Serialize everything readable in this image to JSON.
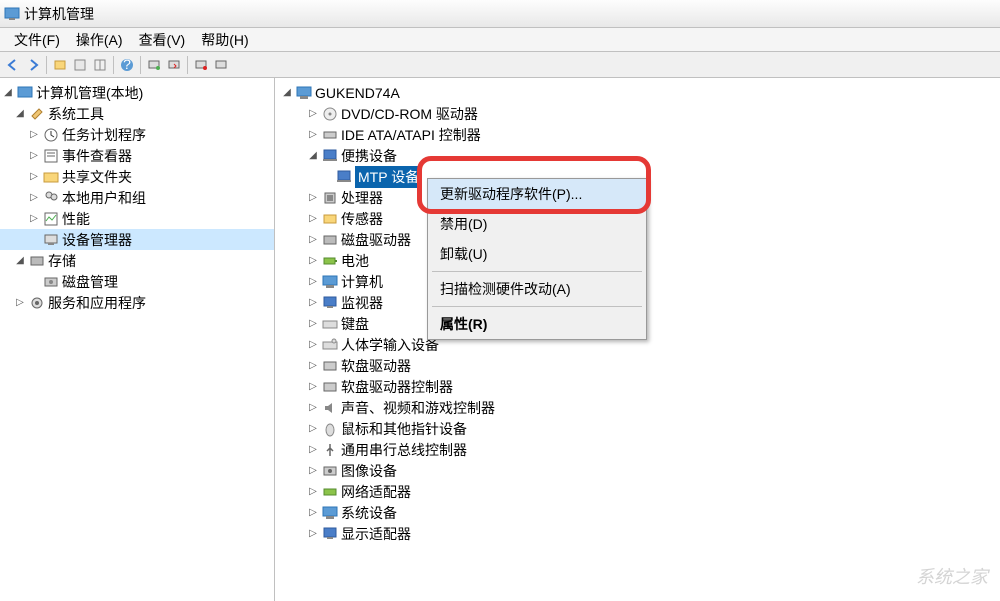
{
  "window": {
    "title": "计算机管理"
  },
  "menu": {
    "file": "文件(F)",
    "action": "操作(A)",
    "view": "查看(V)",
    "help": "帮助(H)"
  },
  "left_tree": {
    "root": "计算机管理(本地)",
    "sys_tools": "系统工具",
    "task_scheduler": "任务计划程序",
    "event_viewer": "事件查看器",
    "shared_folders": "共享文件夹",
    "local_users": "本地用户和组",
    "performance": "性能",
    "device_manager": "设备管理器",
    "storage": "存储",
    "disk_mgmt": "磁盘管理",
    "services": "服务和应用程序"
  },
  "devices": {
    "computer": "GUKEND74A",
    "dvd": "DVD/CD-ROM 驱动器",
    "ide": "IDE ATA/ATAPI 控制器",
    "portable": "便携设备",
    "mtp": "MTP 设备",
    "cpu": "处理器",
    "sensor": "传感器",
    "disk_drive": "磁盘驱动器",
    "battery": "电池",
    "computers": "计算机",
    "monitor": "监视器",
    "keyboard": "键盘",
    "hid": "人体学输入设备",
    "floppy": "软盘驱动器",
    "floppy_ctrl": "软盘驱动器控制器",
    "sound": "声音、视频和游戏控制器",
    "mouse": "鼠标和其他指针设备",
    "usb": "通用串行总线控制器",
    "imaging": "图像设备",
    "network": "网络适配器",
    "system": "系统设备",
    "display": "显示适配器"
  },
  "context_menu": {
    "update_driver": "更新驱动程序软件(P)...",
    "disable": "禁用(D)",
    "uninstall": "卸载(U)",
    "scan": "扫描检测硬件改动(A)",
    "properties": "属性(R)"
  },
  "watermark": "系统之家"
}
